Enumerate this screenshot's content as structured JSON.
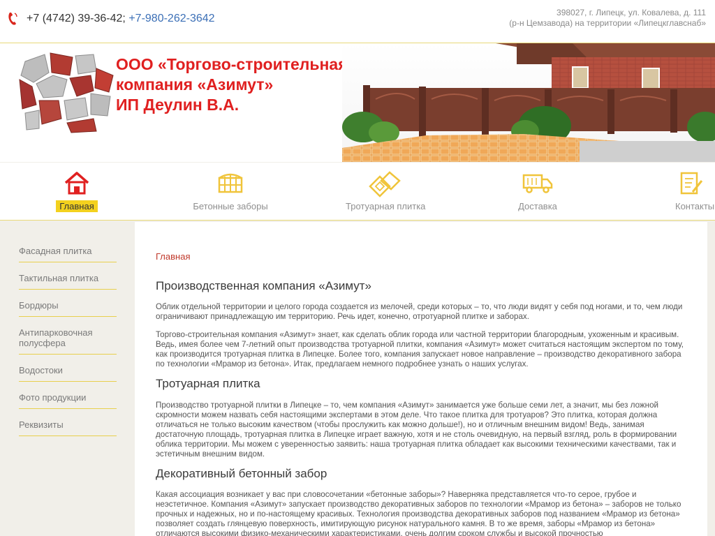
{
  "header": {
    "phone_main": "+7 (4742) 39-36-42;",
    "phone_mobile": "+7-980-262-3642",
    "address_line1": "398027, г. Липецк, ул. Ковалева, д. 111",
    "address_line2": "(р-н Цемзавода) на территории «Липецкглавснаб»"
  },
  "banner": {
    "company_line1": "ООО «Торгово-строительная",
    "company_line2": "компания «Азимут»",
    "company_line3": "ИП Деулин В.А."
  },
  "nav": {
    "items": [
      {
        "label": "Главная",
        "icon": "home-icon",
        "active": true
      },
      {
        "label": "Бетонные заборы",
        "icon": "fence-icon",
        "active": false
      },
      {
        "label": "Тротуарная плитка",
        "icon": "tile-icon",
        "active": false
      },
      {
        "label": "Доставка",
        "icon": "truck-icon",
        "active": false
      },
      {
        "label": "Контакты",
        "icon": "contacts-icon",
        "active": false
      }
    ]
  },
  "sidebar": {
    "items": [
      {
        "label": "Фасадная плитка"
      },
      {
        "label": "Тактильная плитка"
      },
      {
        "label": "Бордюры"
      },
      {
        "label": "Антипарковочная полусфера"
      },
      {
        "label": "Водостоки"
      },
      {
        "label": "Фото продукции"
      },
      {
        "label": "Реквизиты"
      }
    ]
  },
  "content": {
    "breadcrumb": "Главная",
    "section1_title": "Производственная компания «Азимут»",
    "section1_p1": "Облик отдельной территории и целого города создается из мелочей, среди которых – то, что люди видят у себя под ногами, и то, чем люди ограничивают принадлежащую им территорию. Речь идет, конечно, отротуарной плитке и заборах.",
    "section1_p2": "Торгово-строительная компания «Азимут» знает, как сделать облик города или частной территории благородным, ухоженным и красивым. Ведь, имея более чем 7-летний опыт производства тротуарной плитки, компания «Азимут» может считаться настоящим экспертом по тому, как производится тротуарная плитка в Липецке. Более того, компания запускает новое направление – производство декоративного забора по технологии «Мрамор из бетона». Итак, предлагаем немного подробнее узнать о наших услугах.",
    "section2_title": "Тротуарная плитка",
    "section2_p1": "Производство тротуарной плитки в Липецке – то, чем компания «Азимут» занимается уже больше семи лет, а значит, мы без ложной скромности можем назвать себя настоящими экспертами в этом деле. Что такое плитка для тротуаров? Это плитка, которая должна отличаться не только высоким качеством (чтобы прослужить как можно дольше!), но и отличным внешним видом! Ведь, занимая достаточную площадь, тротуарная плитка в Липецке играет важную, хотя и не столь очевидную, на первый взгляд, роль в формировании облика территории. Мы можем с уверенностью заявить: наша тротуарная плитка обладает как высокими техническими качествами, так и эстетичным внешним видом.",
    "section3_title": "Декоративный бетонный забор",
    "section3_p1": "Какая ассоциация возникает у вас при словосочетании «бетонные заборы»? Наверняка представляется что-то серое, грубое и неэстетичное. Компания «Азимут» запускает производство декоративных заборов по технологии «Мрамор из бетона» – заборов не только прочных и надежных, но и по-настоящему красивых. Технология производства декоративных заборов под названием «Мрамор из бетона» позволяет создать глянцевую поверхность, имитирующую рисунок натурального камня. В то же время, заборы «Мрамор из бетона» отличаются высокими физико-механическими характеристиками, очень долгим сроком службы и высокой прочностью"
  },
  "colors": {
    "accent_red": "#e02020",
    "accent_yellow": "#f3d11e",
    "link_blue": "#3b6fb6"
  }
}
